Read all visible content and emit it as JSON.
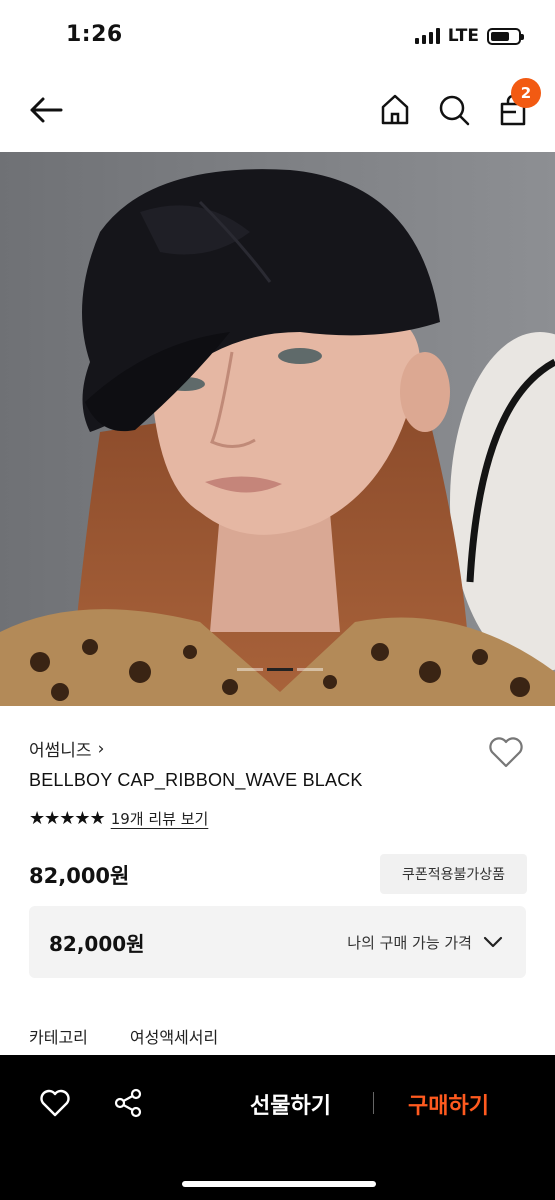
{
  "status": {
    "time": "1:26",
    "network": "LTE",
    "battery_level": 0.7
  },
  "header": {
    "cart_count": "2"
  },
  "icons": {
    "back": "arrow-left-icon",
    "home": "home-icon",
    "search": "search-icon",
    "cart": "shopping-bag-icon",
    "wish": "heart-outline-icon",
    "share": "share-icon",
    "chevron": "chevron-down-icon"
  },
  "gallery": {
    "current_slide": 2,
    "total_slides": 3
  },
  "product": {
    "brand": "어썸니즈",
    "brand_chevron": "›",
    "name": "BELLBOY CAP_RIBBON_WAVE BLACK",
    "rating": 5,
    "stars": "★★★★★",
    "review_link": "19개 리뷰 보기",
    "price": "82,000원",
    "coupon_badge": "쿠폰적용불가상품",
    "my_price": "82,000원",
    "my_price_label": "나의 구매 가능 가격"
  },
  "category": {
    "label": "카테고리",
    "value": "여성액세서리"
  },
  "bottom_bar": {
    "gift_label": "선물하기",
    "buy_label": "구매하기"
  },
  "colors": {
    "accent": "#f25a12",
    "buy_text": "#ff5a1f",
    "bottom_bar_bg": "#000000"
  }
}
